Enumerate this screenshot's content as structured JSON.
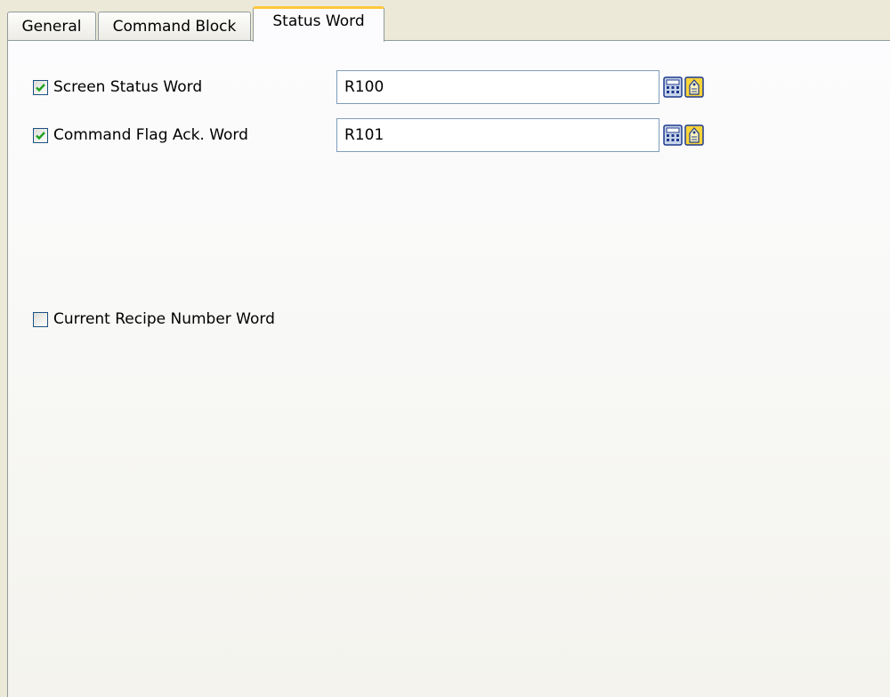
{
  "tabs": [
    {
      "label": "General"
    },
    {
      "label": "Command Block"
    },
    {
      "label": "Status Word",
      "active": true
    }
  ],
  "fields": [
    {
      "label": "Screen Status Word",
      "checked": true,
      "value": "R100"
    },
    {
      "label": "Command Flag Ack. Word",
      "checked": true,
      "value": "R101"
    },
    {
      "label": "Current Recipe Number Word",
      "checked": false
    }
  ],
  "icons": {
    "calculator": "calculator-icon",
    "tag": "tag-icon",
    "checkmark": "checkmark-icon"
  },
  "colors": {
    "check": "#21a121",
    "active_tab_accent": "#ffc83c",
    "icon_blue": "#1e3a8c",
    "icon_yellow": "#f8d43a"
  }
}
